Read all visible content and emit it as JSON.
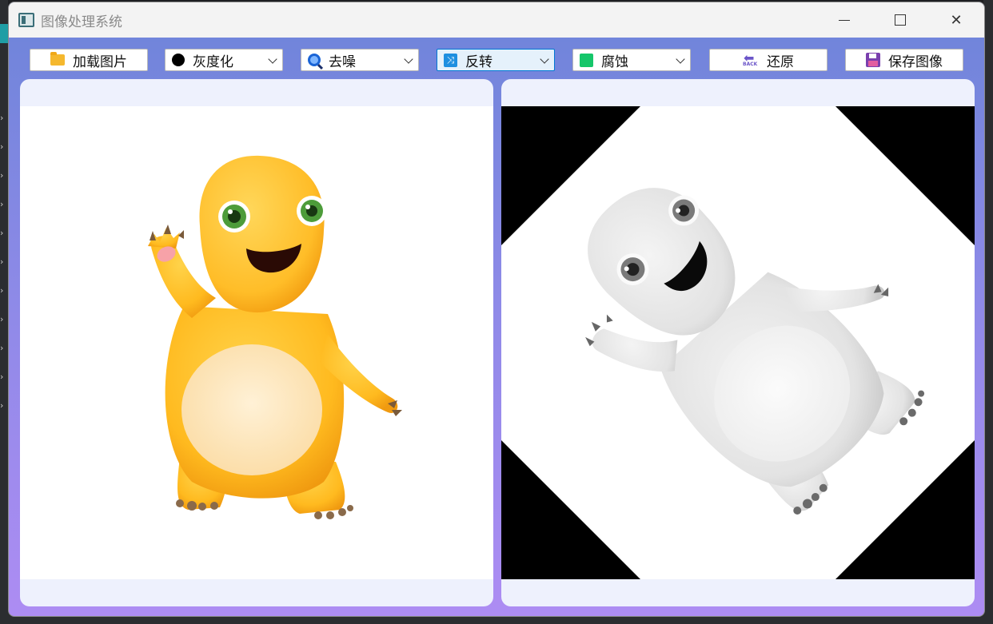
{
  "window": {
    "title": "图像处理系统",
    "controls": [
      "minimize",
      "maximize",
      "close"
    ]
  },
  "toolbar": {
    "load_button": {
      "label": "加载图片",
      "icon": "folder-icon"
    },
    "gray_combo": {
      "value": "灰度化",
      "icon": "dot-icon"
    },
    "denoise_combo": {
      "value": "去噪",
      "icon": "magnifier-icon"
    },
    "flip_combo": {
      "value": "反转",
      "icon": "shuffle-icon"
    },
    "erode_combo": {
      "value": "腐蚀",
      "icon": "square-icon"
    },
    "restore_button": {
      "label": "还原",
      "icon": "back-icon"
    },
    "save_button": {
      "label": "保存图像",
      "icon": "floppy-icon"
    }
  },
  "panels": {
    "original": {
      "content": "yellow cartoon monster waving"
    },
    "processed": {
      "content": "grayscale cartoon monster rotated 45 degrees with black corners"
    }
  },
  "colors": {
    "gradient_top": "#6d84d9",
    "gradient_bottom": "#ad8cf3",
    "panel_bg": "#eef1fd",
    "active_combo_border": "#0078d4"
  }
}
